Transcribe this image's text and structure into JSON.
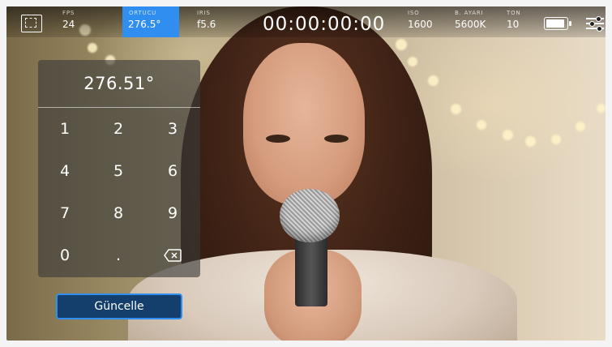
{
  "topbar": {
    "fps": {
      "label": "FPS",
      "value": "24"
    },
    "shutter": {
      "label": "ORTUCU",
      "value": "276.5°"
    },
    "iris": {
      "label": "IRIS",
      "value": "f5.6"
    },
    "timecode": "00:00:00:00",
    "iso": {
      "label": "ISO",
      "value": "1600"
    },
    "white_balance": {
      "label": "B. AYARI",
      "value": "5600K"
    },
    "tint": {
      "label": "TON",
      "value": "10"
    },
    "battery_level": 1.0
  },
  "keypad": {
    "display_value": "276.51°",
    "keys": [
      "1",
      "2",
      "3",
      "4",
      "5",
      "6",
      "7",
      "8",
      "9",
      "0",
      "."
    ],
    "backspace_icon": "backspace-icon"
  },
  "update_button": "Güncelle",
  "colors": {
    "accent": "#2f8ef0",
    "button_bg": "#143e6b"
  }
}
